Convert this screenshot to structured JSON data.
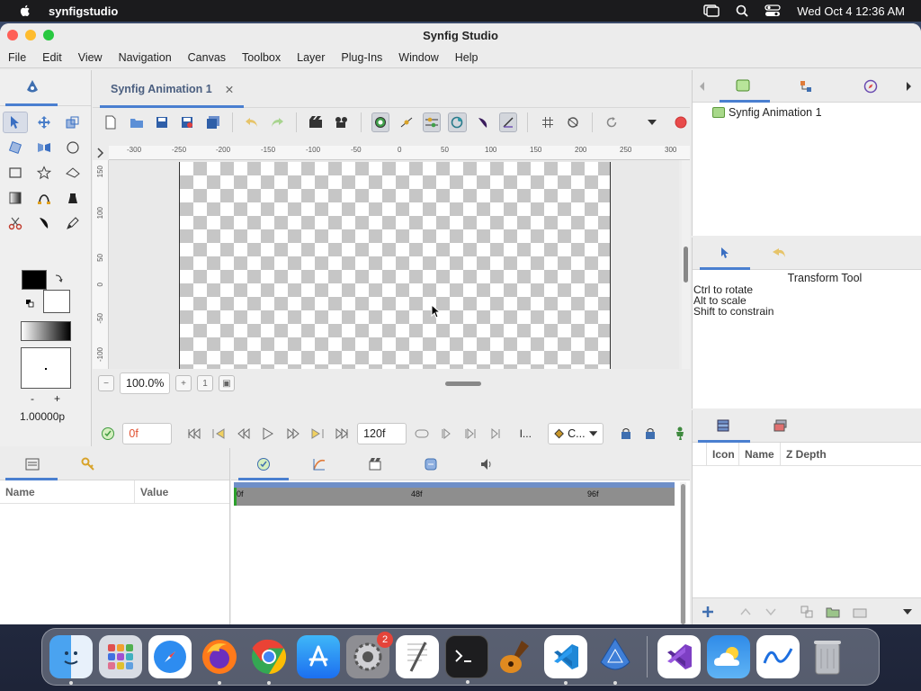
{
  "menubar": {
    "app_name": "synfigstudio",
    "datetime": "Wed Oct 4  12:36 AM"
  },
  "window": {
    "title": "Synfig Studio"
  },
  "menu": {
    "items": [
      "File",
      "Edit",
      "View",
      "Navigation",
      "Canvas",
      "Toolbox",
      "Layer",
      "Plug-Ins",
      "Window",
      "Help"
    ]
  },
  "document": {
    "tab_label": "Synfig Animation 1",
    "close_glyph": "✕"
  },
  "rulers": {
    "top": [
      "-300",
      "-250",
      "-200",
      "-150",
      "-100",
      "-50",
      "0",
      "50",
      "100",
      "150",
      "200",
      "250",
      "300"
    ],
    "left": [
      "150",
      "100",
      "50",
      "0",
      "-50",
      "-100"
    ]
  },
  "canvas_controls": {
    "zoom": "100.0%",
    "current_time": "0f",
    "end_time": "120f",
    "interp_short": "I...",
    "interpolation": "C..."
  },
  "toolbox": {
    "size_value": "1.00000p",
    "minus": "-",
    "plus": "+"
  },
  "canvas_browser": {
    "item": "Synfig Animation 1"
  },
  "tool_options": {
    "title": "Transform Tool",
    "help_lines": [
      "Ctrl to rotate",
      "Alt to scale",
      "Shift to constrain"
    ]
  },
  "layers": {
    "columns": [
      "Icon",
      "Name",
      "Z Depth"
    ]
  },
  "params": {
    "columns": [
      "Name",
      "Value"
    ]
  },
  "timetrack": {
    "labels": [
      "0f",
      "48f",
      "96f"
    ]
  },
  "dock": {
    "apps": [
      "Finder",
      "Launchpad",
      "Safari",
      "Firefox",
      "Chrome",
      "App Store",
      "System Settings",
      "TextEdit",
      "Terminal",
      "GarageBand",
      "VS Code",
      "Synfig",
      "Visual Studio",
      "Weather",
      "Freeform",
      "Trash"
    ],
    "settings_badge": "2"
  },
  "colors": {
    "accent": "#4a7fd0",
    "fill_color": "#000000",
    "outline_color": "#ffffff"
  }
}
